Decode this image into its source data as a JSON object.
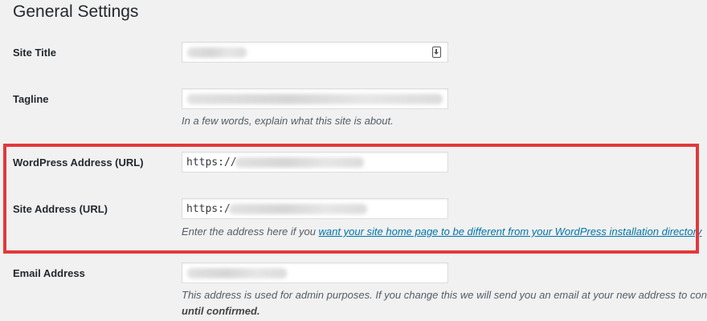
{
  "page": {
    "title": "General Settings"
  },
  "site_title": {
    "label": "Site Title",
    "value_hint": "Kate Hines",
    "icon": "autofill-key-icon"
  },
  "tagline": {
    "label": "Tagline",
    "value_hint": "Weight Loss, Running, and Mindfulness for Geeks and Non",
    "description": "In a few words, explain what this site is about."
  },
  "wordpress_address": {
    "label": "WordPress Address (URL)",
    "value_prefix": "https://"
  },
  "site_address": {
    "label": "Site Address (URL)",
    "value_prefix": "https:/",
    "description_before": "Enter the address here if you ",
    "description_link": "want your site home page to be different from your WordPress installation directory"
  },
  "email_address": {
    "label": "Email Address",
    "description": "This address is used for admin purposes. If you change this we will send you an email at your new address to confi",
    "description_strong": "until confirmed."
  },
  "colors": {
    "highlight_border": "#e2393b",
    "link": "#0073aa",
    "background": "#f1f1f1"
  }
}
